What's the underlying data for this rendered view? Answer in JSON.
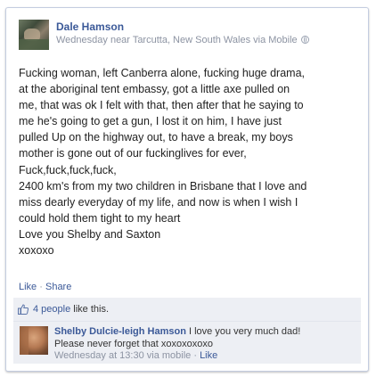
{
  "post": {
    "author": "Dale Hamson",
    "meta": "Wednesday near Tarcutta, New South Wales via Mobile",
    "privacy_icon": "globe-icon",
    "message_lines": [
      "Fucking woman, left Canberra alone, fucking huge drama,",
      "at the aboriginal tent embassy, got a little axe pulled on",
      "me, that was ok I felt with that, then after that he saying to",
      "me he's going to get a gun, I lost it on him, I have just",
      "pulled Up on the highway out, to have a break, my boys",
      "mother is gone out of our fuckinglives for ever,",
      "Fuck,fuck,fuck,fuck,",
      "2400 km's from my two children in Brisbane that I love and",
      "miss dearly everyday of my life, and now is when I wish I",
      "could hold them tight to my heart",
      "Love you Shelby and Saxton",
      "xoxoxo"
    ]
  },
  "actions": {
    "like": "Like",
    "separator": "·",
    "share": "Share"
  },
  "likes": {
    "icon": "thumbs-up-icon",
    "count_text": "4 people",
    "suffix": " like this."
  },
  "comment": {
    "author": "Shelby Dulcie-leigh Hamson",
    "text_line1": " I love you very much dad!",
    "text_line2": "Please never forget that xoxoxoxoxo",
    "meta": "Wednesday at 13:30 via mobile · ",
    "like_label": "Like"
  },
  "colors": {
    "link": "#3b5998",
    "meta": "#8c93a2",
    "feedback_bg": "#edeff4"
  }
}
